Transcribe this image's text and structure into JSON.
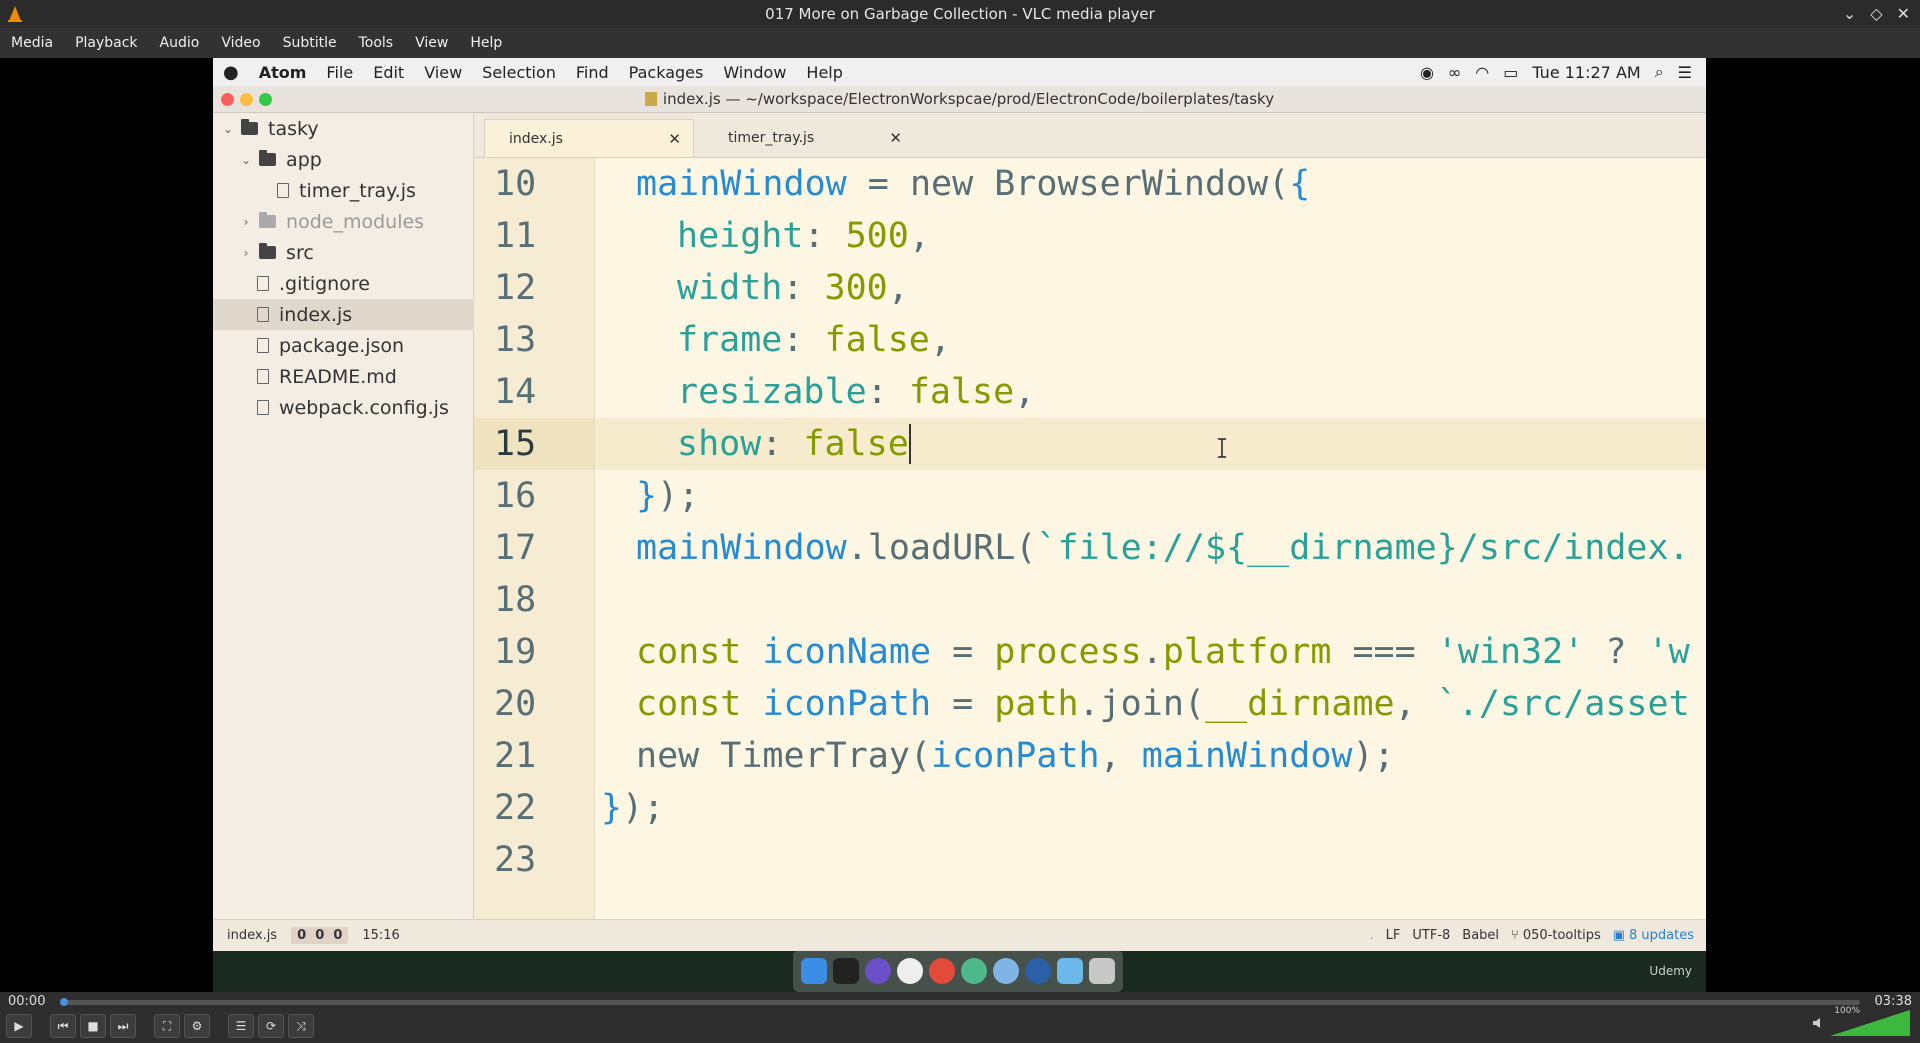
{
  "vlc": {
    "title": "017 More on Garbage Collection - VLC media player",
    "menu": [
      "Media",
      "Playback",
      "Audio",
      "Video",
      "Subtitle",
      "Tools",
      "View",
      "Help"
    ],
    "time_elapsed": "00:00",
    "time_total": "03:38",
    "playback_fraction": 0.0,
    "volume_label": "100%",
    "volume_level": 1.0,
    "accent_color": "#4a90e2"
  },
  "mac": {
    "menu": [
      "Atom",
      "File",
      "Edit",
      "View",
      "Selection",
      "Find",
      "Packages",
      "Window",
      "Help"
    ],
    "clock": "Tue 11:27 AM"
  },
  "atom": {
    "window_title": "index.js — ~/workspace/ElectronWorkspcae/prod/ElectronCode/boilerplates/tasky",
    "tree": [
      {
        "label": "tasky",
        "type": "folder",
        "expanded": true
      },
      {
        "label": "app",
        "type": "folder",
        "expanded": true
      },
      {
        "label": "timer_tray.js",
        "type": "file"
      },
      {
        "label": "node_modules",
        "type": "folder",
        "expanded": false
      },
      {
        "label": "src",
        "type": "folder",
        "expanded": false
      },
      {
        "label": ".gitignore",
        "type": "file"
      },
      {
        "label": "index.js",
        "type": "file",
        "selected": true
      },
      {
        "label": "package.json",
        "type": "file"
      },
      {
        "label": "README.md",
        "type": "file"
      },
      {
        "label": "webpack.config.js",
        "type": "file"
      }
    ],
    "tabs": [
      {
        "label": "index.js",
        "active": true
      },
      {
        "label": "timer_tray.js",
        "active": false
      }
    ],
    "line_numbers": [
      "10",
      "11",
      "12",
      "13",
      "14",
      "15",
      "16",
      "17",
      "18",
      "19",
      "20",
      "21",
      "22",
      "23"
    ],
    "active_line": "15",
    "status": {
      "file": "index.js",
      "counts": [
        "0",
        "0",
        "0"
      ],
      "cursor": "15:16",
      "dot": ".",
      "line_ending": "LF",
      "encoding": "UTF-8",
      "grammar": "Babel",
      "branch": "050-tooltips",
      "updates": "8 updates"
    }
  },
  "watermark": "Udemy"
}
